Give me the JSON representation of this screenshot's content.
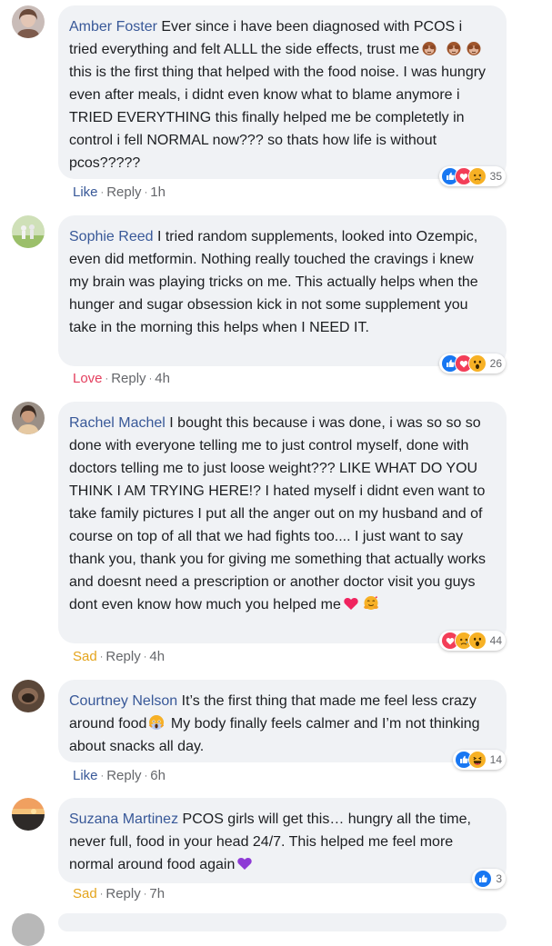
{
  "comments": [
    {
      "author": "Amber Foster",
      "text1": "Ever since i have been diagnosed with PCOS i tried everything and felt ALLL the side effects, trust me",
      "text2": "this is the first thing that helped with the food noise. I was hungry even after meals, i didnt even know what to blame anymore i TRIED EVERYTHING this finally helped me be completetly in control i fell NORMAL now??? so thats how life is without pcos?????",
      "reaction_count": "35",
      "action": "Like",
      "reply": "Reply",
      "time": "1h"
    },
    {
      "author": "Sophie Reed",
      "text1": "I tried random supplements, looked into Ozempic, even did metformin. Nothing really touched the cravings i knew my brain was playing tricks on me. This actually helps when the hunger and sugar obsession kick in not some supplement you take in the morning this helps when I NEED IT.",
      "reaction_count": "26",
      "action": "Love",
      "reply": "Reply",
      "time": "4h"
    },
    {
      "author": "Rachel Machel",
      "text1": "I bought this because i was done, i was so so so done with everyone telling me to just control myself, done with doctors telling me to just loose weight??? LIKE WHAT DO YOU THINK I AM TRYING HERE!? I hated myself i didnt even want to take family pictures I put all the anger out on my husband and of course on top of all that we had fights too.... I just want to say thank you, thank you for giving me something that actually works and doesnt need a prescription or another doctor visit you guys dont even know how much you helped me",
      "reaction_count": "44",
      "action": "Sad",
      "reply": "Reply",
      "time": "4h"
    },
    {
      "author": "Courtney Nelson",
      "text1": "It’s the first thing that made me feel less crazy around food",
      "text2": "My body finally feels calmer and I’m not thinking about snacks all day.",
      "reaction_count": "14",
      "action": "Like",
      "reply": "Reply",
      "time": "6h"
    },
    {
      "author": "Suzana Martinez",
      "text1": "PCOS girls will get this… hungry all the time, never full, food in your head 24/7. This helped me feel more normal around food again",
      "reaction_count": "3",
      "action": "Sad",
      "reply": "Reply",
      "time": "7h"
    }
  ],
  "colors": {
    "author": "#385898",
    "bubble": "#f0f2f5",
    "like_blue": "#1877f2",
    "love_red": "#f33e58",
    "haha_yellow": "#f7b125"
  },
  "icons": [
    "like-icon",
    "love-icon",
    "sad-icon",
    "wow-icon",
    "haha-icon",
    "see-no-evil-monkey-emoji",
    "heart-emoji",
    "hugging-face-emoji",
    "screaming-face-emoji",
    "purple-heart-emoji"
  ]
}
